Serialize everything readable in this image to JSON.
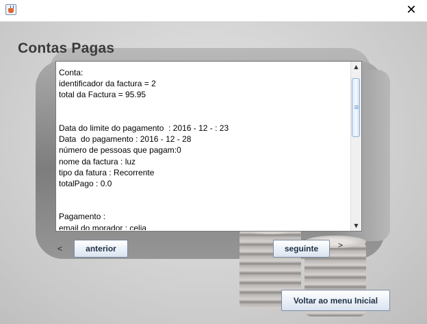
{
  "window": {
    "close_symbol": "✕"
  },
  "header": {
    "title": "Contas Pagas"
  },
  "details": {
    "lines": [
      "Conta:",
      "identificador da factura = 2",
      "total da Factura = 95.95",
      "",
      "",
      "Data do limite do pagamento  : 2016 - 12 - : 23",
      "Data  do pagamento : 2016 - 12 - 28",
      "número de pessoas que pagam:0",
      "nome da factura : luz",
      "tipo da fatura : Recorrente",
      "totalPago : 0.0",
      "",
      "",
      "Pagamento :",
      "email do morador : celia"
    ]
  },
  "nav": {
    "prev_arrow": "<",
    "prev_label": "anterior",
    "next_label": "seguinte",
    "next_arrow": ">",
    "back_label": "Voltar ao menu Inicial"
  },
  "icons": {
    "app": "java-coffee-icon",
    "close": "close-icon",
    "scroll_up": "scroll-up-arrow-icon",
    "scroll_down": "scroll-down-arrow-icon"
  }
}
